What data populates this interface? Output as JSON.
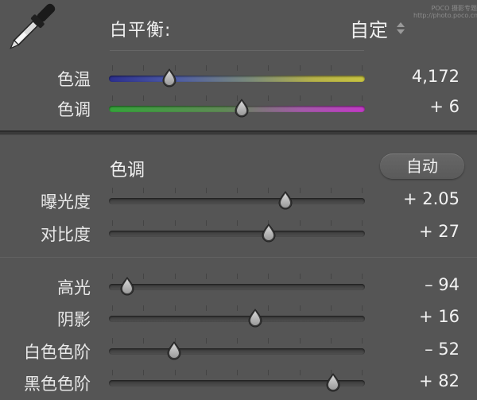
{
  "white_balance": {
    "title": "白平衡:",
    "mode": "自定",
    "watermark": "POCO 摄影专题 http://photo.poco.cn"
  },
  "wb_sliders": [
    {
      "label": "色温",
      "value": "4,172",
      "position": 0.235,
      "track": "temp"
    },
    {
      "label": "色调",
      "value": "+ 6",
      "position": 0.52,
      "track": "tint"
    }
  ],
  "tone": {
    "title": "色调",
    "auto_label": "自动"
  },
  "tone_sliders": [
    {
      "label": "曝光度",
      "value": "+ 2.05",
      "position": 0.69,
      "track": "gray"
    },
    {
      "label": "对比度",
      "value": "+ 27",
      "position": 0.625,
      "track": "gray"
    }
  ],
  "presence_sliders": [
    {
      "label": "高光",
      "value": "– 94",
      "position": 0.07,
      "track": "gray"
    },
    {
      "label": "阴影",
      "value": "+ 16",
      "position": 0.57,
      "track": "gray"
    },
    {
      "label": "白色色阶",
      "value": "– 52",
      "position": 0.255,
      "track": "gray"
    },
    {
      "label": "黑色色阶",
      "value": "+ 82",
      "position": 0.875,
      "track": "gray"
    }
  ],
  "colors": {
    "background": "#555555",
    "text": "#e6e6e6",
    "temp_start": "#2c2f8e",
    "temp_end": "#c8c441",
    "tint_start": "#35a33a",
    "tint_end": "#c23ac6"
  }
}
